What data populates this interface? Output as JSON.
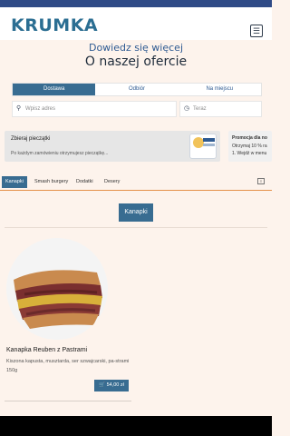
{
  "brand": {
    "logo": "KRUMKA"
  },
  "header": {
    "menu_icon": "hamburger-icon"
  },
  "hero": {
    "tagline": "Dowiedz się więcej",
    "title": "O naszej ofercie"
  },
  "delivery_modes": [
    {
      "label": "Dostawa",
      "active": true
    },
    {
      "label": "Odbiór",
      "active": false
    },
    {
      "label": "Na miejscu",
      "active": false
    }
  ],
  "address": {
    "placeholder": "Wpisz adres",
    "icon": "location-pin-icon"
  },
  "time": {
    "value": "Teraz",
    "icon": "clock-icon"
  },
  "promos": [
    {
      "title": "Zbieraj pieczątki",
      "desc": "Po każdym zamówieniu otrzymujesz pieczątkę..."
    },
    {
      "title": "Promocja dla no",
      "desc_line1": "Otrzymaj 10 % ra",
      "desc_line2": "1. Wejdź w menu"
    }
  ],
  "categories": [
    "Kanapki",
    "Smash burgery",
    "Dodatki",
    "Desery"
  ],
  "category_menu_icon": "list-icon",
  "section": {
    "title": "Kanapki"
  },
  "product": {
    "name": "Kanapka Reuben z Pastrami",
    "desc": "Kiszona kapusta, musztarda, ser szwajcarski, pa-strami 150g",
    "price": "54,00 zł",
    "cart_icon": "cart-icon"
  },
  "colors": {
    "accent": "#386c91",
    "background": "#fdf3ec",
    "top_strip": "#2f4a86",
    "underline": "#e49048"
  }
}
